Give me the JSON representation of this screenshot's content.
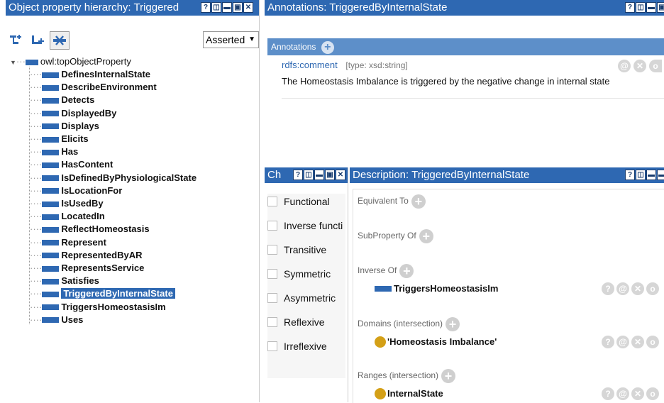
{
  "left_panel": {
    "title": "Object property hierarchy: Triggered",
    "mode": "Asserted",
    "root": "owl:topObjectProperty",
    "items": [
      "DefinesInternalState",
      "DescribeEnvironment",
      "Detects",
      "DisplayedBy",
      "Displays",
      "Elicits",
      "Has",
      "HasContent",
      "IsDefinedByPhysiologicalState",
      "IsLocationFor",
      "IsUsedBy",
      "LocatedIn",
      "ReflectHomeostasis",
      "Represent",
      "RepresentedByAR",
      "RepresentsService",
      "Satisfies",
      "TriggeredByInternalState",
      "TriggersHomeostasisIm",
      "Uses"
    ],
    "selected_index": 17
  },
  "annotations": {
    "title": "Annotations: TriggeredByInternalState",
    "header": "Annotations",
    "property": "rdfs:comment",
    "type": "[type: xsd:string]",
    "value": "The Homeostasis Imbalance is triggered by the negative change in internal state"
  },
  "characteristics": {
    "title": "Ch",
    "items": [
      "Functional",
      "Inverse functi",
      "Transitive",
      "Symmetric",
      "Asymmetric",
      "Reflexive",
      "Irreflexive"
    ]
  },
  "description": {
    "title": "Description: TriggeredByInternalState",
    "equivalent_to": "Equivalent To",
    "subproperty_of": "SubProperty Of",
    "inverse_of": "Inverse Of",
    "inverse_value": "TriggersHomeostasisIm",
    "domains": "Domains (intersection)",
    "domain_value": "'Homeostasis Imbalance'",
    "ranges": "Ranges (intersection)",
    "range_value": "InternalState"
  },
  "colors": {
    "accent": "#2e68b2",
    "class_dot": "#d4a017"
  }
}
